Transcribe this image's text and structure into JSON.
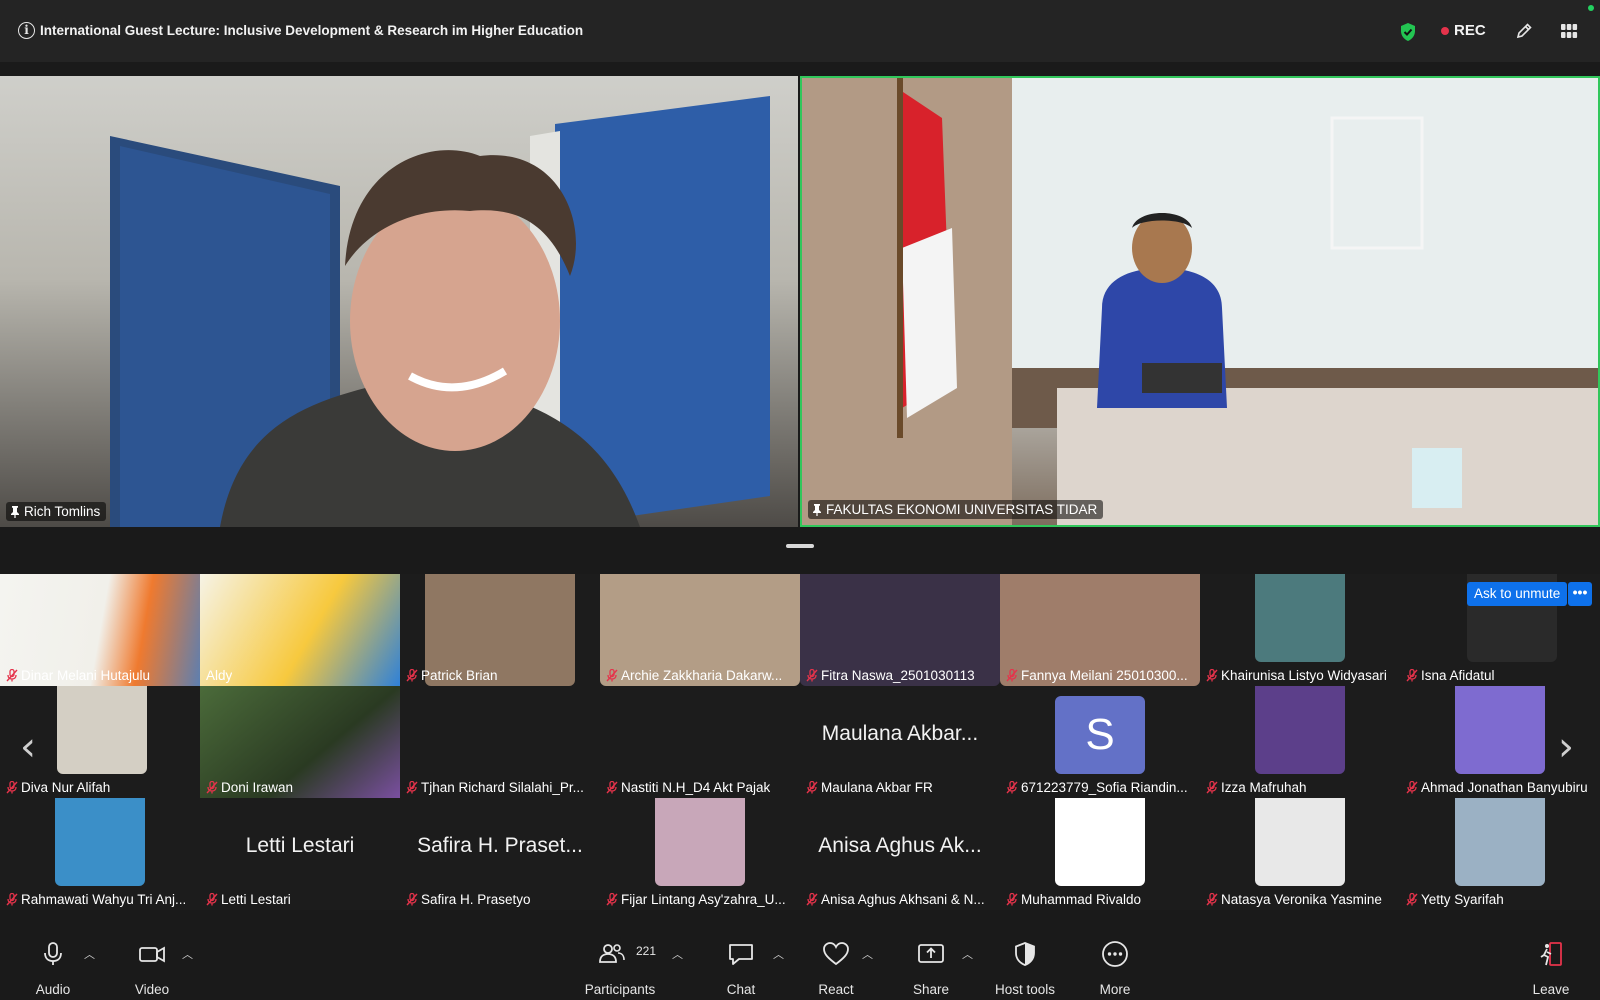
{
  "meeting": {
    "title": "International Guest Lecture: Inclusive Development & Research im Higher Education",
    "rec_label": "REC"
  },
  "main_videos": [
    {
      "name": "Rich Tomlins"
    },
    {
      "name": "FAKULTAS EKONOMI UNIVERSITAS TIDAR"
    }
  ],
  "gallery": {
    "ask_to_unmute": "Ask to unmute",
    "more_label": "•••",
    "tiles": [
      {
        "name": "Dinar Melani Hutajulu",
        "big": ""
      },
      {
        "name": "Aldy",
        "big": ""
      },
      {
        "name": "Patrick Brian",
        "big": ""
      },
      {
        "name": "Archie Zakkharia Dakarw...",
        "big": ""
      },
      {
        "name": "Fitra Naswa_2501030113",
        "big": ""
      },
      {
        "name": "Fannya Meilani 25010300...",
        "big": ""
      },
      {
        "name": "Khairunisa Listyo Widyasari",
        "big": ""
      },
      {
        "name": "Isna Afidatul",
        "big": ""
      },
      {
        "name": "Diva Nur Alifah",
        "big": ""
      },
      {
        "name": "Doni Irawan",
        "big": ""
      },
      {
        "name": "Tjhan Richard Silalahi_Pr...",
        "big": ""
      },
      {
        "name": "Nastiti N.H_D4 Akt Pajak",
        "big": ""
      },
      {
        "name": "Maulana Akbar FR",
        "big": "Maulana Akbar..."
      },
      {
        "name": "671223779_Sofia Riandin...",
        "big": ""
      },
      {
        "name": "Izza Mafruhah",
        "big": ""
      },
      {
        "name": "Ahmad Jonathan Banyubiru",
        "big": ""
      },
      {
        "name": "Rahmawati Wahyu Tri Anj...",
        "big": ""
      },
      {
        "name": "Letti Lestari",
        "big": "Letti Lestari"
      },
      {
        "name": "Safira H. Prasetyo",
        "big": "Safira H. Praset..."
      },
      {
        "name": "Fijar Lintang Asy'zahra_U...",
        "big": ""
      },
      {
        "name": "Anisa Aghus Akhsani & N...",
        "big": "Anisa Aghus Ak..."
      },
      {
        "name": "Muhammad Rivaldo",
        "big": ""
      },
      {
        "name": "Natasya Veronika Yasmine",
        "big": ""
      },
      {
        "name": "Yetty Syarifah",
        "big": ""
      }
    ],
    "sofia_avatar_letter": "S",
    "arrow_left": "‹",
    "arrow_right": "›"
  },
  "toolbar": {
    "audio": "Audio",
    "video": "Video",
    "participants": "Participants",
    "participants_count": "221",
    "chat": "Chat",
    "react": "React",
    "share": "Share",
    "host_tools": "Host tools",
    "more": "More",
    "leave": "Leave"
  },
  "colors": {
    "active_speaker_border": "#31c75b",
    "rec_dot": "#e5334b",
    "unmute_button": "#0e71eb",
    "muted_mic": "#e5334b",
    "avatar_s": "#6371c7"
  }
}
